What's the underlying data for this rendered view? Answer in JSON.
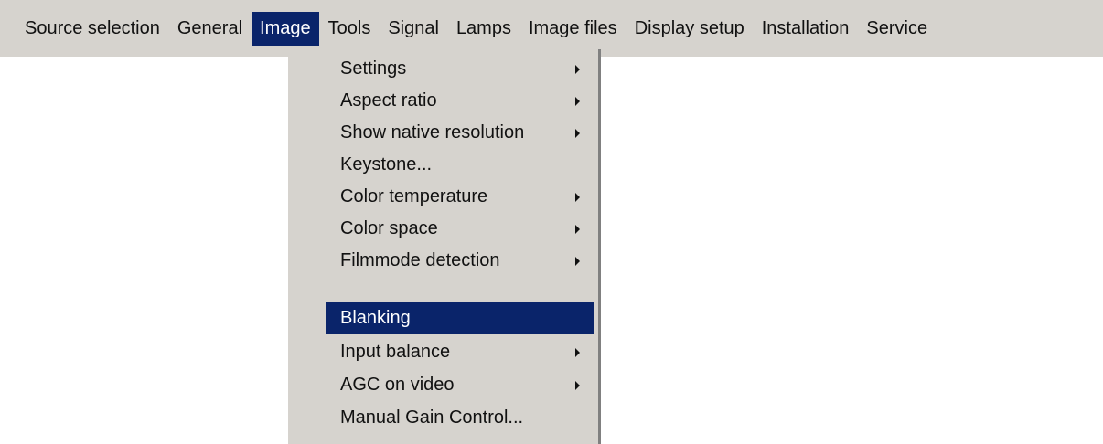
{
  "menubar": {
    "items": [
      {
        "label": "Source selection"
      },
      {
        "label": "General"
      },
      {
        "label": "Image",
        "active": true
      },
      {
        "label": "Tools"
      },
      {
        "label": "Signal"
      },
      {
        "label": "Lamps"
      },
      {
        "label": "Image files"
      },
      {
        "label": "Display setup"
      },
      {
        "label": "Installation"
      },
      {
        "label": "Service"
      }
    ]
  },
  "image_menu": {
    "items": [
      {
        "label": "Settings",
        "submenu": true,
        "icon": "submenu-arrow-icon"
      },
      {
        "label": "Aspect ratio",
        "submenu": true,
        "icon": "submenu-arrow-icon"
      },
      {
        "label": "Show native resolution",
        "submenu": true,
        "icon": "submenu-arrow-icon"
      },
      {
        "label": "Keystone...",
        "submenu": false
      },
      {
        "label": "Color temperature",
        "submenu": true,
        "icon": "submenu-arrow-icon"
      },
      {
        "label": "Color space",
        "submenu": true,
        "icon": "submenu-arrow-icon"
      },
      {
        "label": "Filmmode detection",
        "submenu": true,
        "icon": "submenu-arrow-icon"
      },
      {
        "label": "Blanking",
        "submenu": false,
        "selected": true
      },
      {
        "label": "Input balance",
        "submenu": true,
        "icon": "submenu-arrow-icon"
      },
      {
        "label": "AGC on video",
        "submenu": true,
        "icon": "submenu-arrow-icon"
      },
      {
        "label": "Manual Gain Control...",
        "submenu": false
      }
    ]
  },
  "colors": {
    "menu_background": "#d6d3ce",
    "highlight": "#0a246a",
    "highlight_text": "#ffffff",
    "text": "#111111"
  }
}
